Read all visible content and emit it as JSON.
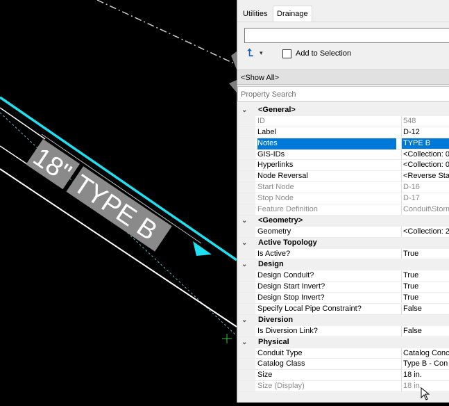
{
  "cad_view": {
    "label_number": "18\"",
    "label_type": "TYPE B",
    "colors": {
      "pipe": "#1ee0f0",
      "line": "#ffffff",
      "dashed": "#cfcfcf",
      "label_bg": "#8a8a8a"
    }
  },
  "panel": {
    "tabs": [
      "Utilities",
      "Drainage"
    ],
    "active_tab": "Drainage",
    "add_to_selection_label": "Add to Selection",
    "show_all_label": "<Show All>",
    "property_search_placeholder": "Property Search",
    "rows": [
      {
        "type": "category",
        "name": "<General>"
      },
      {
        "type": "property",
        "name": "ID",
        "value": "548",
        "readonly": true
      },
      {
        "type": "property",
        "name": "Label",
        "value": "D-12"
      },
      {
        "type": "property",
        "name": "Notes",
        "value": "TYPE B",
        "selected": true
      },
      {
        "type": "property",
        "name": "GIS-IDs",
        "value": "<Collection: 0"
      },
      {
        "type": "property",
        "name": "Hyperlinks",
        "value": "<Collection: 0"
      },
      {
        "type": "property",
        "name": "Node Reversal",
        "value": "<Reverse Sta"
      },
      {
        "type": "property",
        "name": "Start Node",
        "value": "D-16",
        "readonly": true
      },
      {
        "type": "property",
        "name": "Stop Node",
        "value": "D-17",
        "readonly": true
      },
      {
        "type": "property",
        "name": "Feature Definition",
        "value": "Conduit\\Storm",
        "readonly": true
      },
      {
        "type": "category",
        "name": "<Geometry>"
      },
      {
        "type": "property",
        "name": "Geometry",
        "value": "<Collection: 2"
      },
      {
        "type": "category",
        "name": "Active Topology"
      },
      {
        "type": "property",
        "name": "Is Active?",
        "value": "True"
      },
      {
        "type": "category",
        "name": "Design"
      },
      {
        "type": "property",
        "name": "Design Conduit?",
        "value": "True"
      },
      {
        "type": "property",
        "name": "Design Start Invert?",
        "value": "True"
      },
      {
        "type": "property",
        "name": "Design Stop Invert?",
        "value": "True"
      },
      {
        "type": "property",
        "name": "Specify Local Pipe Constraint?",
        "value": "False"
      },
      {
        "type": "category",
        "name": "Diversion"
      },
      {
        "type": "property",
        "name": "Is Diversion Link?",
        "value": "False"
      },
      {
        "type": "category",
        "name": "Physical"
      },
      {
        "type": "property",
        "name": "Conduit Type",
        "value": "Catalog Conc"
      },
      {
        "type": "property",
        "name": "Catalog Class",
        "value": "Type B - Con"
      },
      {
        "type": "property",
        "name": "Size",
        "value": "18 in."
      },
      {
        "type": "property",
        "name": "Size (Display)",
        "value": "18 in.",
        "readonly": true
      }
    ]
  }
}
